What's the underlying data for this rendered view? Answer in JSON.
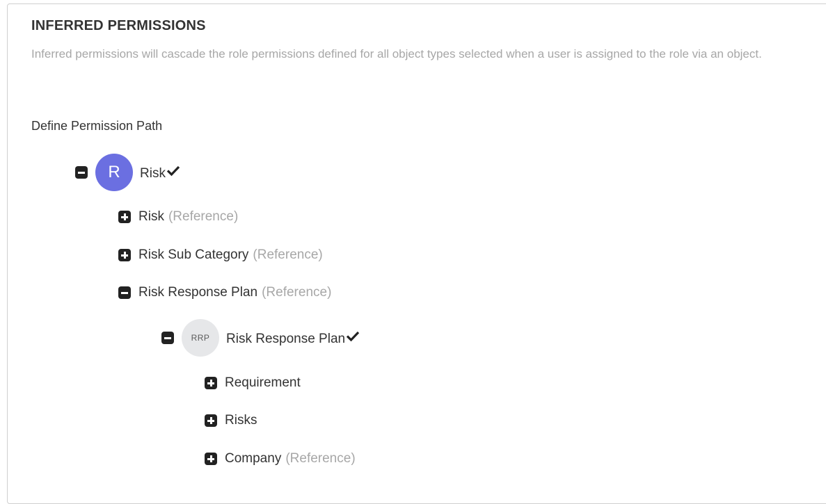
{
  "section": {
    "title": "INFERRED PERMISSIONS",
    "description": "Inferred permissions will cascade the role permissions defined for all object types selected when a user is assigned to the role via an object."
  },
  "path_label": "Define Permission Path",
  "tree": {
    "root": {
      "avatar_text": "R",
      "label": "Risk",
      "expanded": true,
      "selected": true,
      "children": [
        {
          "label": "Risk",
          "suffix": "(Reference)",
          "expanded": false
        },
        {
          "label": "Risk Sub Category",
          "suffix": "(Reference)",
          "expanded": false
        },
        {
          "label": "Risk Response Plan",
          "suffix": "(Reference)",
          "expanded": true,
          "child": {
            "avatar_text": "RRP",
            "label": "Risk Response Plan",
            "expanded": true,
            "selected": true,
            "children": [
              {
                "label": "Requirement",
                "expanded": false
              },
              {
                "label": "Risks",
                "expanded": false
              },
              {
                "label": "Company",
                "suffix": "(Reference)",
                "expanded": false
              }
            ]
          }
        }
      ]
    }
  },
  "colors": {
    "primary_avatar": "#6b6fe1",
    "muted_avatar": "#e6e7e9",
    "muted_text": "#a7a7a7",
    "toggle": "#222222"
  },
  "icons": {
    "expand": "plus-square-icon",
    "collapse": "minus-square-icon",
    "selected": "checkmark-icon"
  }
}
